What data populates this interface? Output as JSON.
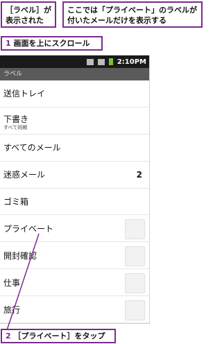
{
  "callouts": {
    "label_shown": "［ラベル］が表示された",
    "description": "ここでは「プライベート」のラベルが付いたメールだけを表示する"
  },
  "steps": [
    {
      "num": "1",
      "text": "画面を上にスクロール"
    },
    {
      "num": "2",
      "text": "［プライベート］をタップ"
    }
  ],
  "status_bar": {
    "time": "2:10PM"
  },
  "header": {
    "title": "ラベル"
  },
  "labels": [
    {
      "name": "送信トレイ"
    },
    {
      "name": "下書き",
      "sub": "すべて同期"
    },
    {
      "name": "すべてのメール"
    },
    {
      "name": "迷惑メール",
      "count": "2"
    },
    {
      "name": "ゴミ箱"
    },
    {
      "name": "プライベート"
    },
    {
      "name": "開封確認"
    },
    {
      "name": "仕事"
    },
    {
      "name": "旅行"
    }
  ]
}
